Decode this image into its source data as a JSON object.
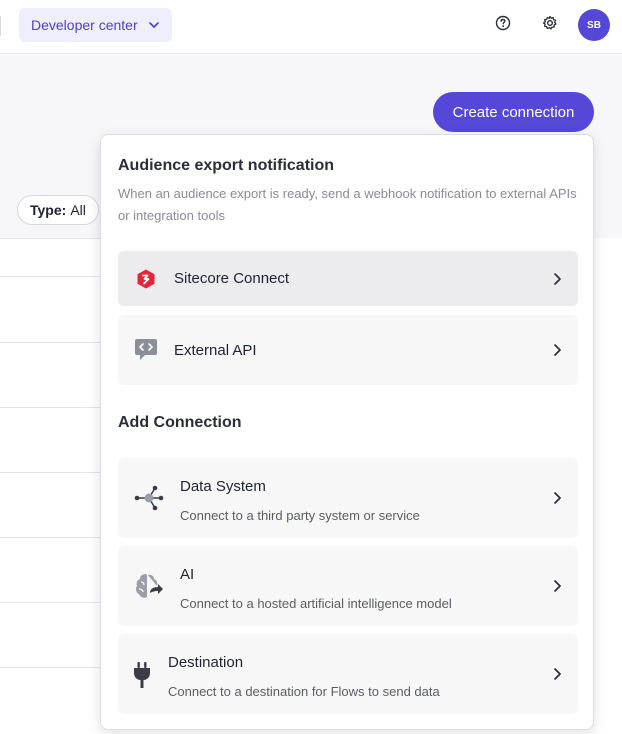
{
  "topbar": {
    "developer_center_label": "Developer center",
    "avatar_initials": "SB"
  },
  "page": {
    "create_connection_label": "Create connection",
    "type_filter_label": "Type:",
    "type_filter_value": "All"
  },
  "popover": {
    "audience_section": {
      "title": "Audience export notification",
      "description": "When an audience export is ready, send a webhook notification to external APIs or integration tools",
      "items": [
        {
          "label": "Sitecore Connect",
          "icon": "sitecore-connect-icon"
        },
        {
          "label": "External API",
          "icon": "code-chat-icon"
        }
      ]
    },
    "add_section": {
      "title": "Add Connection",
      "items": [
        {
          "title": "Data System",
          "subtitle": "Connect to a third party system or service",
          "icon": "network-icon"
        },
        {
          "title": "AI",
          "subtitle": "Connect to a hosted artificial intelligence model",
          "icon": "brain-icon"
        },
        {
          "title": "Destination",
          "subtitle": "Connect to a destination for Flows to send data",
          "icon": "plug-icon"
        }
      ]
    }
  },
  "colors": {
    "accent": "#5548d9",
    "accent_light": "#efeefc",
    "sitecore_red": "#e0283a"
  }
}
